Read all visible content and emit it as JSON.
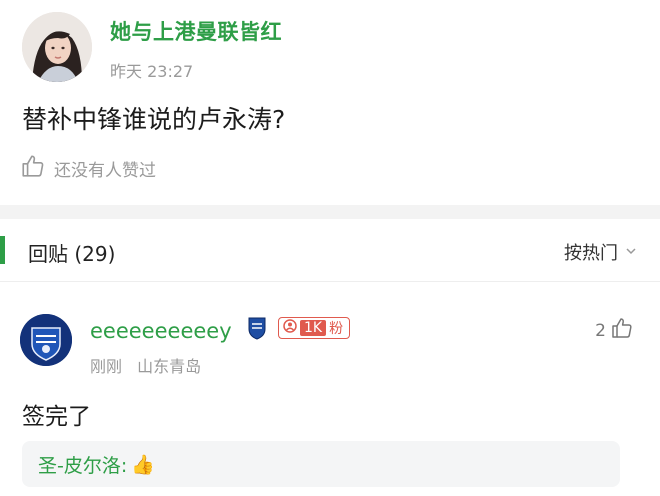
{
  "post": {
    "author": "她与上港曼联皆红",
    "time": "昨天 23:27",
    "content": "替补中锋谁说的卢永涛?",
    "likes_text": "还没有人赞过"
  },
  "replies_header": {
    "label": "回贴 (29)",
    "sort_label": "按热门"
  },
  "reply": {
    "username": "eeeeeeeeeey",
    "fan_badge": "1K",
    "fan_badge_suffix": "粉",
    "time": "刚刚",
    "location": "山东青岛",
    "like_count": "2",
    "content": "签完了",
    "sub_reply": {
      "author": "圣-皮尔洛:",
      "emoji": "👍"
    }
  },
  "colors": {
    "accent_green": "#2e9e47",
    "badge_red": "#e05a4e",
    "muted_text": "#9a9a9a"
  }
}
